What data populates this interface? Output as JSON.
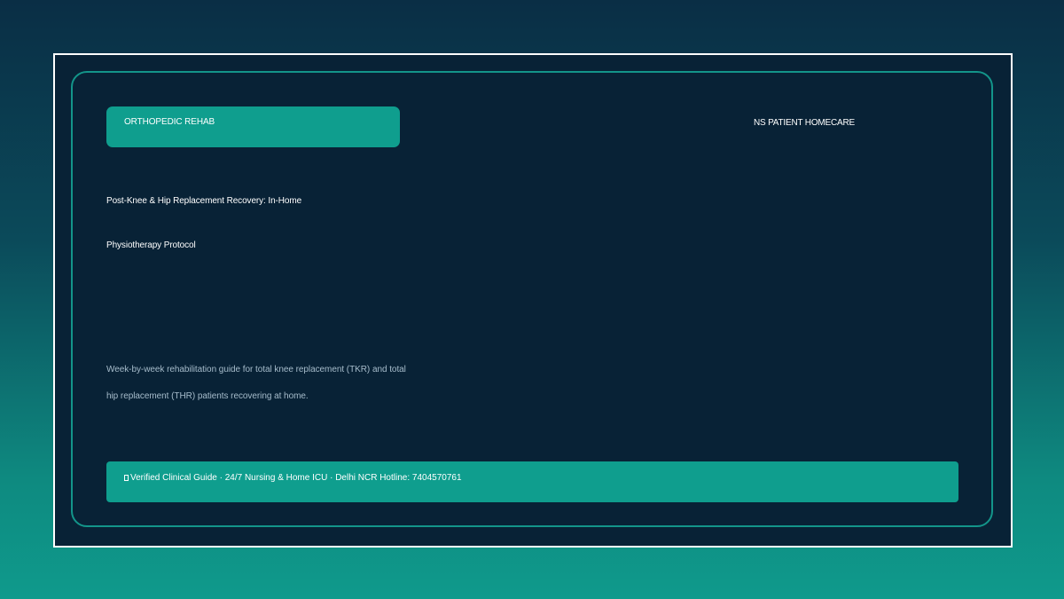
{
  "card": {
    "tag": "ORTHOPEDIC REHAB",
    "brand": "NS PATIENT HOMECARE",
    "title": {
      "line1": "Post-Knee & Hip Replacement Recovery: In-Home",
      "line2": "Physiotherapy Protocol"
    },
    "description": {
      "line1": "Week-by-week rehabilitation guide for total knee replacement (TKR) and total",
      "line2": "hip replacement (THR) patients recovering at home."
    },
    "footer": {
      "icon": "verified-check-icon",
      "text": "Verified Clinical Guide · 24/7 Nursing & Home ICU · Delhi NCR Hotline: 7404570761"
    }
  },
  "colors": {
    "accent": "#0f9e8e",
    "card_bg": "#082236",
    "border": "#13958a"
  }
}
